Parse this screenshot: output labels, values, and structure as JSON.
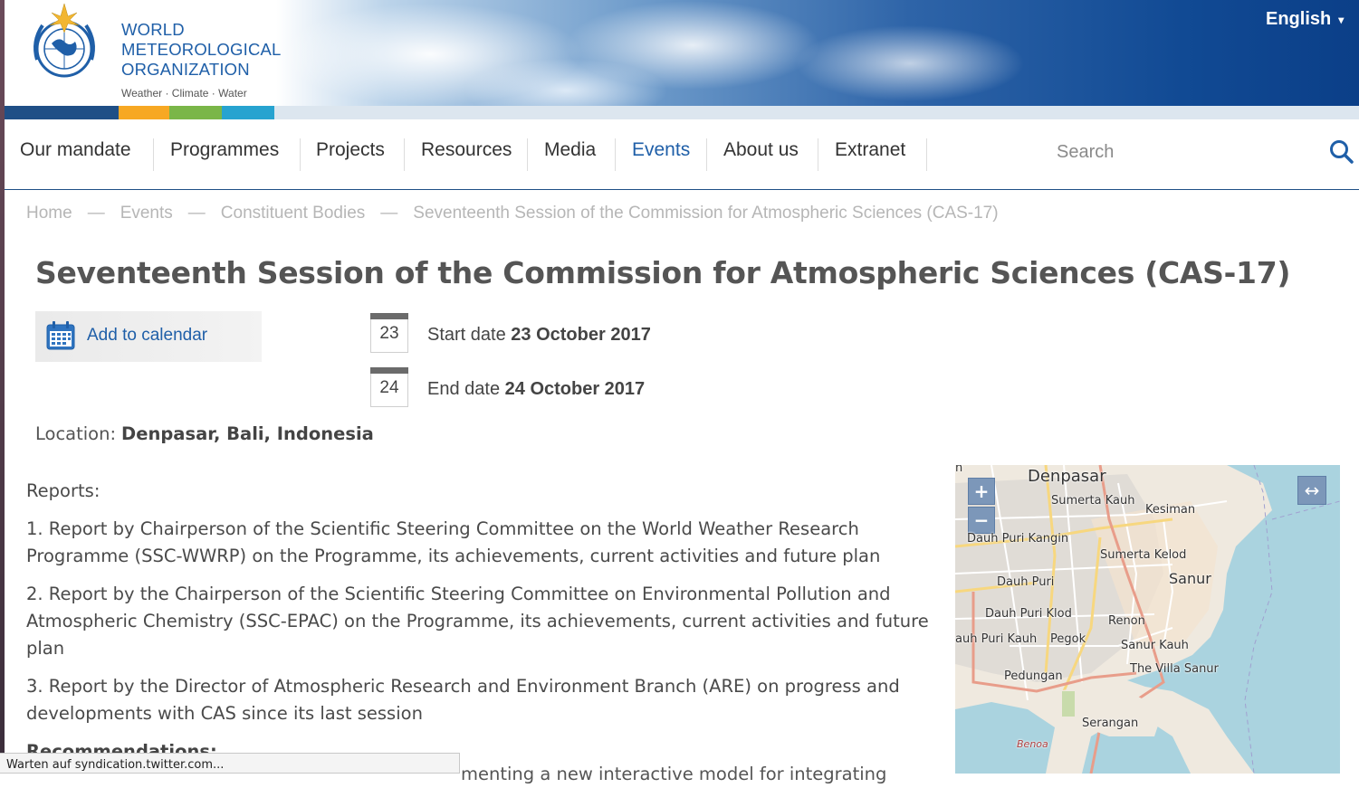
{
  "header": {
    "org_line1": "WORLD",
    "org_line2": "METEOROLOGICAL",
    "org_line3": "ORGANIZATION",
    "tagline": "Weather · Climate · Water",
    "language": "English",
    "color_bar": [
      "#1f4f86",
      "#f7a823",
      "#7ab648",
      "#27a3d0"
    ]
  },
  "nav": {
    "items": [
      "Our mandate",
      "Programmes",
      "Projects",
      "Resources",
      "Media",
      "Events",
      "About us",
      "Extranet"
    ],
    "active": "Events",
    "search_placeholder": "Search"
  },
  "breadcrumb": [
    "Home",
    "Events",
    "Constituent Bodies",
    "Seventeenth Session of the Commission for Atmospheric Sciences (CAS-17)"
  ],
  "breadcrumb_separator": "—",
  "event": {
    "title": "Seventeenth Session of the Commission for Atmospheric Sciences (CAS-17)",
    "add_to_calendar": "Add to calendar",
    "start_day": "23",
    "start_label": "Start date",
    "start_date": "23 October 2017",
    "end_day": "24",
    "end_label": "End date",
    "end_date": "24 October 2017",
    "location_label": "Location:",
    "location": "Denpasar, Bali, Indonesia"
  },
  "content": {
    "reports_heading": "Reports",
    "reports_colon": ":",
    "reports": [
      "1. Report by Chairperson of the Scientific Steering Committee on the World Weather Research Programme (SSC-WWRP) on the Programme, its achievements, current activities and future plan",
      "2. Report by the Chairperson of the Scientific Steering Committee on Environmental Pollution and Atmospheric Chemistry (SSC-EPAC) on the Programme, its achievements, current activities and future plan",
      "3. Report by the Director of Atmospheric Research and Environment Branch (ARE) on progress and developments with CAS since its last session"
    ],
    "recommendations_heading": "Recommendations:",
    "tail_text": "menting a new interactive model for integrating"
  },
  "map": {
    "zoom_in": "+",
    "zoom_out": "−",
    "expand": "↔",
    "labels": [
      "Denpasar",
      "Sumerta Kauh",
      "Kesiman",
      "Dauh Puri Kangin",
      "Sumerta Kelod",
      "Sanur",
      "Dauh Puri",
      "Dauh Puri Klod",
      "Renon",
      "auh Puri Kauh",
      "Pegok",
      "Sanur Kauh",
      "Pedungan",
      "The Villa Sanur",
      "Serangan",
      "Benoa",
      "n"
    ],
    "water_color": "#aad3df",
    "land_color": "#efe9df"
  },
  "status": {
    "text": "Warten auf syndication.twitter.com..."
  }
}
